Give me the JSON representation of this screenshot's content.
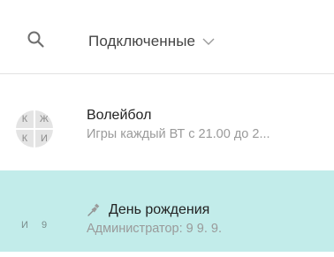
{
  "header": {
    "search_icon": "search-icon",
    "filter_label": "Подключенные",
    "filter_icon": "chevron-down-icon"
  },
  "chats": [
    {
      "title": "Волейбол",
      "subtitle": "Игры каждый ВТ с 21.00 до 2...",
      "avatar_initials": [
        "К",
        "Ж",
        "К",
        "И"
      ],
      "selected": false
    },
    {
      "title": "День рождения",
      "subtitle": "Администратор: 9 9. 9.",
      "avatar_initials": [
        "И",
        "9"
      ],
      "pinned_icon": "pin-icon",
      "selected": true
    }
  ],
  "colors": {
    "selected_background": "#c2ecea",
    "avatar_background": "#e4e4e4",
    "subtitle_text": "#9a9a9a",
    "divider": "#e2e2e2"
  }
}
